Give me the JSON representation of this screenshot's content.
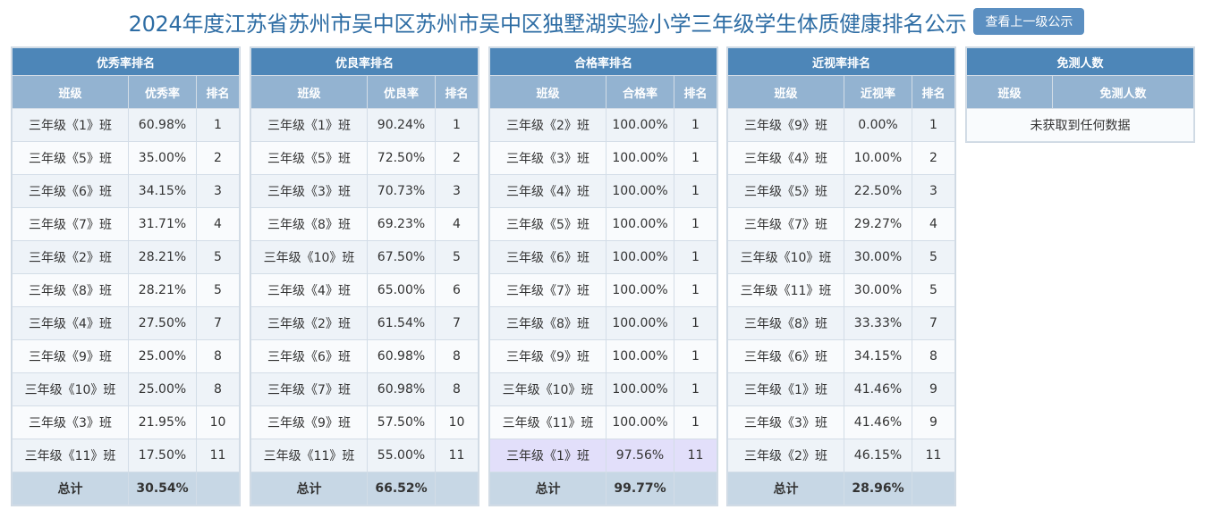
{
  "header": {
    "title": "2024年度江苏省苏州市吴中区苏州市吴中区独墅湖实验小学三年级学生体质健康排名公示",
    "button_label": "查看上一级公示"
  },
  "panels": [
    {
      "title": "优秀率排名",
      "columns": [
        "班级",
        "优秀率",
        "排名"
      ],
      "rows": [
        [
          "三年级《1》班",
          "60.98%",
          "1"
        ],
        [
          "三年级《5》班",
          "35.00%",
          "2"
        ],
        [
          "三年级《6》班",
          "34.15%",
          "3"
        ],
        [
          "三年级《7》班",
          "31.71%",
          "4"
        ],
        [
          "三年级《2》班",
          "28.21%",
          "5"
        ],
        [
          "三年级《8》班",
          "28.21%",
          "5"
        ],
        [
          "三年级《4》班",
          "27.50%",
          "7"
        ],
        [
          "三年级《9》班",
          "25.00%",
          "8"
        ],
        [
          "三年级《10》班",
          "25.00%",
          "8"
        ],
        [
          "三年级《3》班",
          "21.95%",
          "10"
        ],
        [
          "三年级《11》班",
          "17.50%",
          "11"
        ]
      ],
      "total": [
        "总计",
        "30.54%",
        ""
      ]
    },
    {
      "title": "优良率排名",
      "columns": [
        "班级",
        "优良率",
        "排名"
      ],
      "rows": [
        [
          "三年级《1》班",
          "90.24%",
          "1"
        ],
        [
          "三年级《5》班",
          "72.50%",
          "2"
        ],
        [
          "三年级《3》班",
          "70.73%",
          "3"
        ],
        [
          "三年级《8》班",
          "69.23%",
          "4"
        ],
        [
          "三年级《10》班",
          "67.50%",
          "5"
        ],
        [
          "三年级《4》班",
          "65.00%",
          "6"
        ],
        [
          "三年级《2》班",
          "61.54%",
          "7"
        ],
        [
          "三年级《6》班",
          "60.98%",
          "8"
        ],
        [
          "三年级《7》班",
          "60.98%",
          "8"
        ],
        [
          "三年级《9》班",
          "57.50%",
          "10"
        ],
        [
          "三年级《11》班",
          "55.00%",
          "11"
        ]
      ],
      "total": [
        "总计",
        "66.52%",
        ""
      ]
    },
    {
      "title": "合格率排名",
      "columns": [
        "班级",
        "合格率",
        "排名"
      ],
      "rows": [
        [
          "三年级《2》班",
          "100.00%",
          "1"
        ],
        [
          "三年级《3》班",
          "100.00%",
          "1"
        ],
        [
          "三年级《4》班",
          "100.00%",
          "1"
        ],
        [
          "三年级《5》班",
          "100.00%",
          "1"
        ],
        [
          "三年级《6》班",
          "100.00%",
          "1"
        ],
        [
          "三年级《7》班",
          "100.00%",
          "1"
        ],
        [
          "三年级《8》班",
          "100.00%",
          "1"
        ],
        [
          "三年级《9》班",
          "100.00%",
          "1"
        ],
        [
          "三年级《10》班",
          "100.00%",
          "1"
        ],
        [
          "三年级《11》班",
          "100.00%",
          "1"
        ],
        [
          "三年级《1》班",
          "97.56%",
          "11"
        ]
      ],
      "total": [
        "总计",
        "99.77%",
        ""
      ]
    },
    {
      "title": "近视率排名",
      "columns": [
        "班级",
        "近视率",
        "排名"
      ],
      "rows": [
        [
          "三年级《9》班",
          "0.00%",
          "1"
        ],
        [
          "三年级《4》班",
          "10.00%",
          "2"
        ],
        [
          "三年级《5》班",
          "22.50%",
          "3"
        ],
        [
          "三年级《7》班",
          "29.27%",
          "4"
        ],
        [
          "三年级《10》班",
          "30.00%",
          "5"
        ],
        [
          "三年级《11》班",
          "30.00%",
          "5"
        ],
        [
          "三年级《8》班",
          "33.33%",
          "7"
        ],
        [
          "三年级《6》班",
          "34.15%",
          "8"
        ],
        [
          "三年级《1》班",
          "41.46%",
          "9"
        ],
        [
          "三年级《3》班",
          "41.46%",
          "9"
        ],
        [
          "三年级《2》班",
          "46.15%",
          "11"
        ]
      ],
      "total": [
        "总计",
        "28.96%",
        ""
      ]
    }
  ],
  "exempt": {
    "title": "免测人数",
    "columns": [
      "班级",
      "免测人数"
    ],
    "empty_text": "未获取到任何数据"
  }
}
